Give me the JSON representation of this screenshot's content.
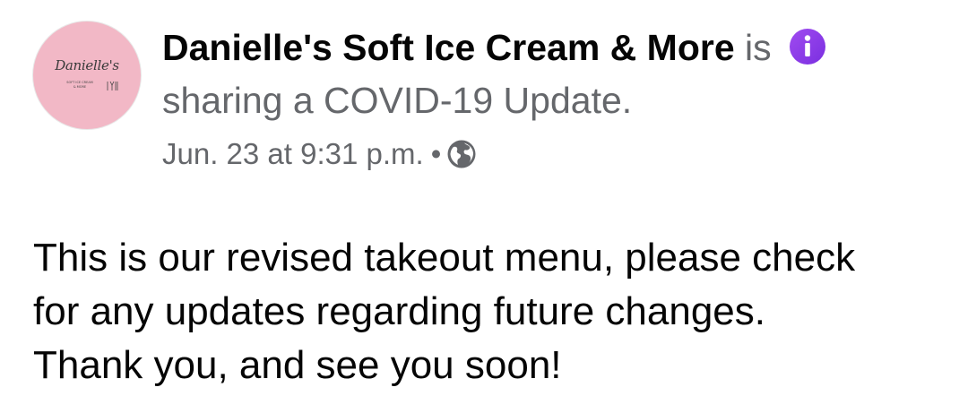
{
  "post": {
    "avatar": {
      "brand_script": "Danielle's",
      "brand_sub_line1": "SOFT ICE CREAM",
      "brand_sub_line2": "& MORE",
      "background_color": "#f2b8c6",
      "utensils_icon": "ice-cream-utensils-icon"
    },
    "header": {
      "page_name": "Danielle's Soft Ice Cream & More",
      "verb": "is",
      "info_icon": "info-icon",
      "info_icon_color": "#8f3be6",
      "action_text": "sharing a COVID-19 Update."
    },
    "meta": {
      "timestamp": "Jun. 23 at 9:31 p.m.",
      "separator": "•",
      "audience_icon": "globe-icon"
    },
    "message": {
      "lines": [
        "This is our revised takeout menu, please check",
        "for any updates regarding future changes.",
        "Thank you, and see you soon!"
      ]
    }
  }
}
